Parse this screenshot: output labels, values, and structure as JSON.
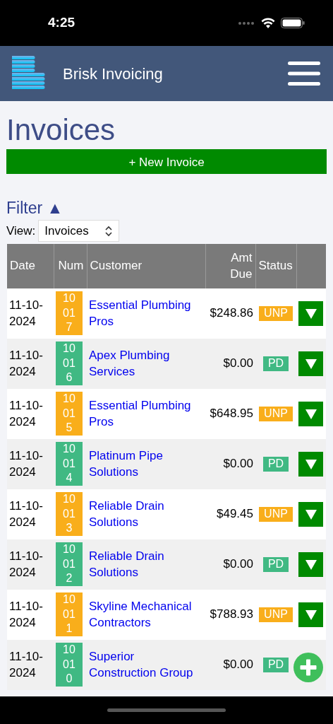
{
  "status_bar": {
    "time": "4:25"
  },
  "app": {
    "title": "Brisk Invoicing"
  },
  "page": {
    "title": "Invoices",
    "new_button": "+ New Invoice"
  },
  "filter": {
    "label": "Filter ▲",
    "view_label": "View:",
    "view_value": "Invoices"
  },
  "table": {
    "columns": [
      "Date",
      "Num",
      "Customer",
      "Amt Due",
      "Status"
    ],
    "rows": [
      {
        "date": "11-10-2024",
        "num": "10017",
        "customer": "Essential Plumbing Pros",
        "amount": "$248.86",
        "status": "UNP",
        "kind": "unpaid"
      },
      {
        "date": "11-10-2024",
        "num": "10016",
        "customer": "Apex Plumbing Services",
        "amount": "$0.00",
        "status": "PD",
        "kind": "paid"
      },
      {
        "date": "11-10-2024",
        "num": "10015",
        "customer": "Essential Plumbing Pros",
        "amount": "$648.95",
        "status": "UNP",
        "kind": "unpaid"
      },
      {
        "date": "11-10-2024",
        "num": "10014",
        "customer": "Platinum Pipe Solutions",
        "amount": "$0.00",
        "status": "PD",
        "kind": "paid"
      },
      {
        "date": "11-10-2024",
        "num": "10013",
        "customer": "Reliable Drain Solutions",
        "amount": "$49.45",
        "status": "UNP",
        "kind": "unpaid"
      },
      {
        "date": "11-10-2024",
        "num": "10012",
        "customer": "Reliable Drain Solutions",
        "amount": "$0.00",
        "status": "PD",
        "kind": "paid"
      },
      {
        "date": "11-10-2024",
        "num": "10011",
        "customer": "Skyline Mechanical Contractors",
        "amount": "$788.93",
        "status": "UNP",
        "kind": "unpaid"
      },
      {
        "date": "11-10-2024",
        "num": "10010",
        "customer": "Superior Construction Group",
        "amount": "$0.00",
        "status": "PD",
        "kind": "paid"
      }
    ]
  }
}
